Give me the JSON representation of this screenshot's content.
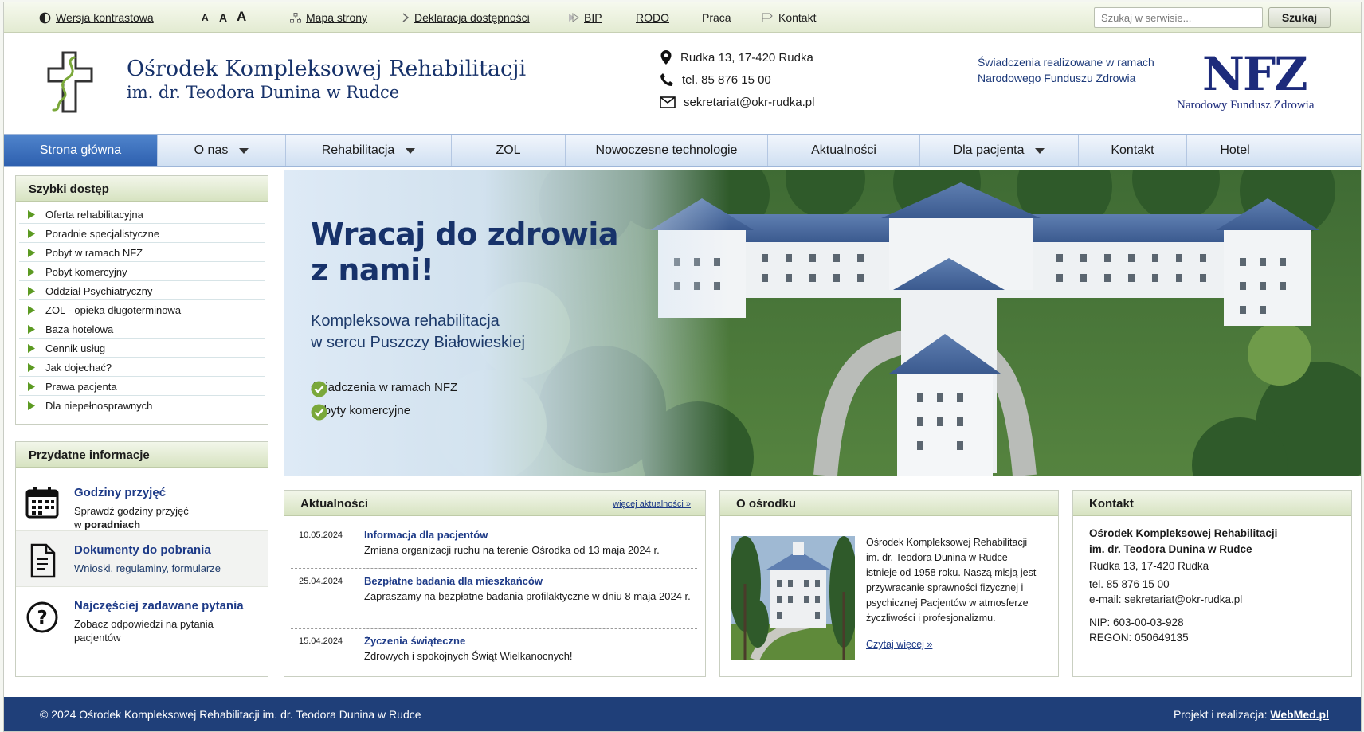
{
  "topbar": {
    "contrast_label": "Wersja kontrastowa",
    "font_small": "A",
    "font_medium": "A",
    "font_large": "A",
    "links": [
      {
        "label": "Mapa strony",
        "icon": "sitemap-icon"
      },
      {
        "label": "Deklaracja dostępności",
        "icon": "arrow-icon"
      },
      {
        "label": "BIP",
        "icon": "bip-icon"
      },
      {
        "label": "RODO"
      },
      {
        "label": "Praca"
      },
      {
        "label": "Kontakt",
        "icon": "flag-icon"
      }
    ],
    "search_placeholder": "Szukaj w serwisie...",
    "search_button": "Szukaj"
  },
  "header": {
    "title_line1": "Ośrodek Kompleksowej Rehabilitacji",
    "title_line2": "im. dr. Teodora Dunina w Rudce",
    "address": "Rudka 13, 17-420 Rudka",
    "phone": "tel. 85 876 15 00",
    "email": "sekretariat@okr-rudka.pl",
    "nfz_text_line1": "Świadczenia realizowane w ramach",
    "nfz_text_line2": "Narodowego Funduszu Zdrowia",
    "nfz_logo": "NFZ",
    "nfz_logo_sub": "Narodowy Fundusz Zdrowia"
  },
  "nav": {
    "items": [
      {
        "label": "Strona główna",
        "active": true
      },
      {
        "label": "O nas",
        "dropdown": true
      },
      {
        "label": "Rehabilitacja",
        "dropdown": true
      },
      {
        "label": "ZOL"
      },
      {
        "label": "Nowoczesne technologie"
      },
      {
        "label": "Aktualności"
      },
      {
        "label": "Dla pacjenta",
        "dropdown": true
      },
      {
        "label": "Kontakt"
      },
      {
        "label": "Hotel"
      }
    ]
  },
  "quick_access": {
    "title": "Szybki dostęp",
    "items": [
      "Oferta rehabilitacyjna",
      "Poradnie specjalistyczne",
      "Pobyt w ramach NFZ",
      "Pobyt komercyjny",
      "Oddział Psychiatryczny",
      "ZOL - opieka długoterminowa",
      "Baza hotelowa",
      "Cennik usług",
      "Jak dojechać?",
      "Prawa pacjenta",
      "Dla niepełnosprawnych"
    ]
  },
  "useful_info": {
    "title": "Przydatne informacje",
    "items": [
      {
        "title": "Godziny przyjęć",
        "desc_line1": "Sprawdź godziny przyjęć",
        "desc_line2_prefix": "w ",
        "desc_line2_bold": "poradniach",
        "icon": "calendar-icon"
      },
      {
        "title": "Dokumenty do pobrania",
        "desc_line1": "Wnioski, regulaminy, formularze",
        "icon": "document-icon"
      },
      {
        "title": "Najczęściej zadawane pytania",
        "desc_line1": "Zobacz odpowiedzi na pytania",
        "desc_line2": "pacjentów",
        "icon": "question-icon"
      }
    ]
  },
  "hero": {
    "heading_line1": "Wracaj do zdrowia",
    "heading_line2": "z nami!",
    "sub_line1": "Kompleksowa rehabilitacja",
    "sub_line2": "w sercu Puszczy Białowieskiej",
    "checks": [
      "świadczenia w ramach NFZ",
      "pobyty komercyjne"
    ]
  },
  "news": {
    "title": "Aktualności",
    "more_link": "więcej aktualności »",
    "items": [
      {
        "date": "10.05.2024",
        "title": "Informacja dla pacjentów",
        "desc": "Zmiana organizacji ruchu na terenie Ośrodka od 13 maja 2024 r."
      },
      {
        "date": "25.04.2024",
        "title": "Bezpłatne badania dla mieszkańców",
        "desc": "Zapraszamy na bezpłatne badania profilaktyczne w dniu 8 maja 2024 r."
      },
      {
        "date": "15.04.2024",
        "title": "Życzenia świąteczne",
        "desc": "Zdrowych i spokojnych Świąt Wielkanocnych!"
      }
    ]
  },
  "about": {
    "title": "O ośrodku",
    "text": "Ośrodek Kompleksowej Rehabilitacji im. dr. Teodora Dunina w Rudce istnieje od 1958 roku. Naszą misją jest przywracanie sprawności fizycznej i psychicznej Pacjentów w atmosferze życzliwości i profesjonalizmu.",
    "more": "Czytaj więcej »"
  },
  "contact": {
    "title": "Kontakt",
    "name_line1": "Ośrodek Kompleksowej Rehabilitacji",
    "name_line2": "im. dr. Teodora Dunina w Rudce",
    "address": "Rudka 13, 17-420 Rudka",
    "phone": "tel. 85 876 15 00",
    "email": "e-mail: sekretariat@okr-rudka.pl",
    "nip": "NIP: 603-00-03-928",
    "regon": "REGON: 050649135"
  },
  "footer": {
    "copyright": "© 2024 Ośrodek Kompleksowej Rehabilitacji im. dr. Teodora Dunina w Rudce",
    "credit_prefix": "Projekt i realizacja:",
    "credit_link": "WebMed.pl"
  },
  "colors": {
    "navy": "#17326a",
    "link_blue": "#1d3a87",
    "nav_active": "#2d5fae",
    "green_accent": "#7aa83a",
    "footer": "#1f3f79"
  }
}
